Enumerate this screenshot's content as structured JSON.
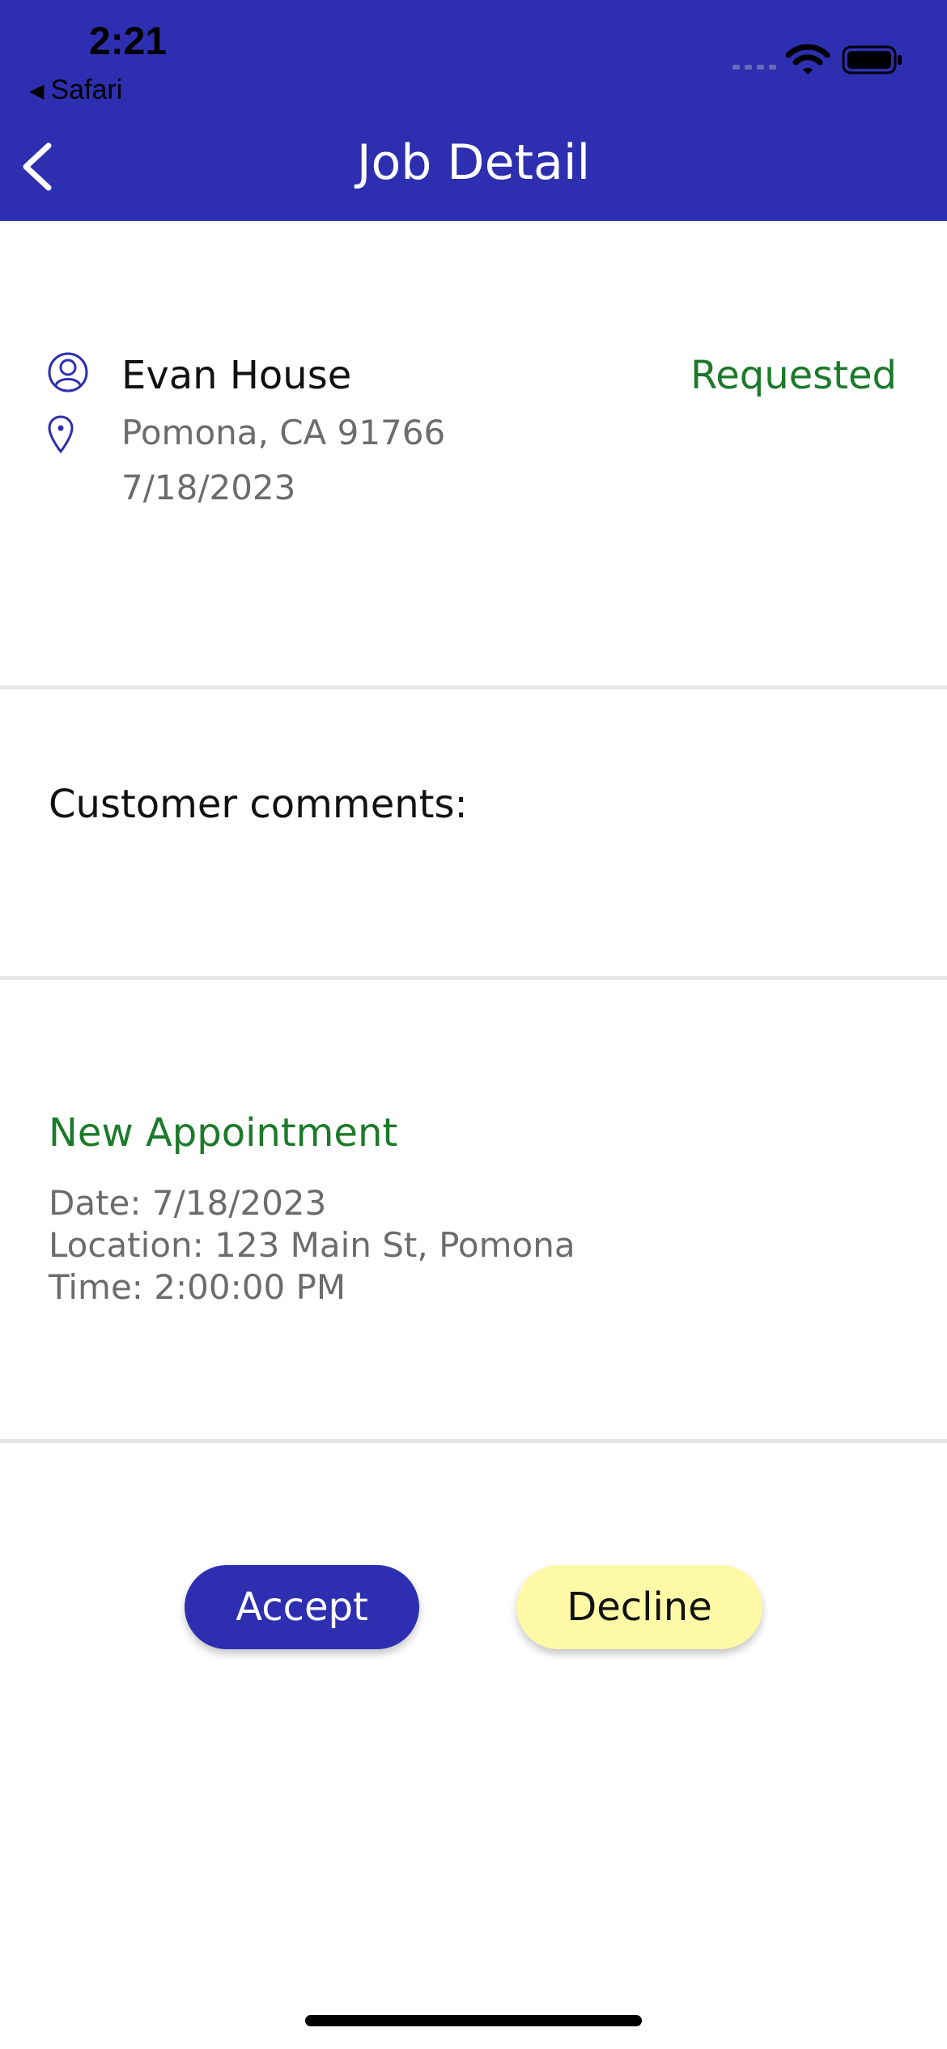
{
  "status_bar": {
    "time": "2:21",
    "back_app": "Safari"
  },
  "nav": {
    "title": "Job Detail",
    "back_icon": "chevron-left-icon"
  },
  "job": {
    "name": "Evan House",
    "status": "Requested",
    "address": "Pomona, CA 91766",
    "date": "7/18/2023"
  },
  "comments": {
    "label": "Customer comments:"
  },
  "appointment": {
    "title": "New Appointment",
    "date_line": "Date: 7/18/2023",
    "location_line": "Location: 123 Main St, Pomona",
    "time_line": "Time: 2:00:00 PM"
  },
  "actions": {
    "accept_label": "Accept",
    "decline_label": "Decline"
  },
  "colors": {
    "brand": "#2d2fb0",
    "status_green": "#1c7a2a",
    "decline_bg": "#fdf9a6"
  }
}
